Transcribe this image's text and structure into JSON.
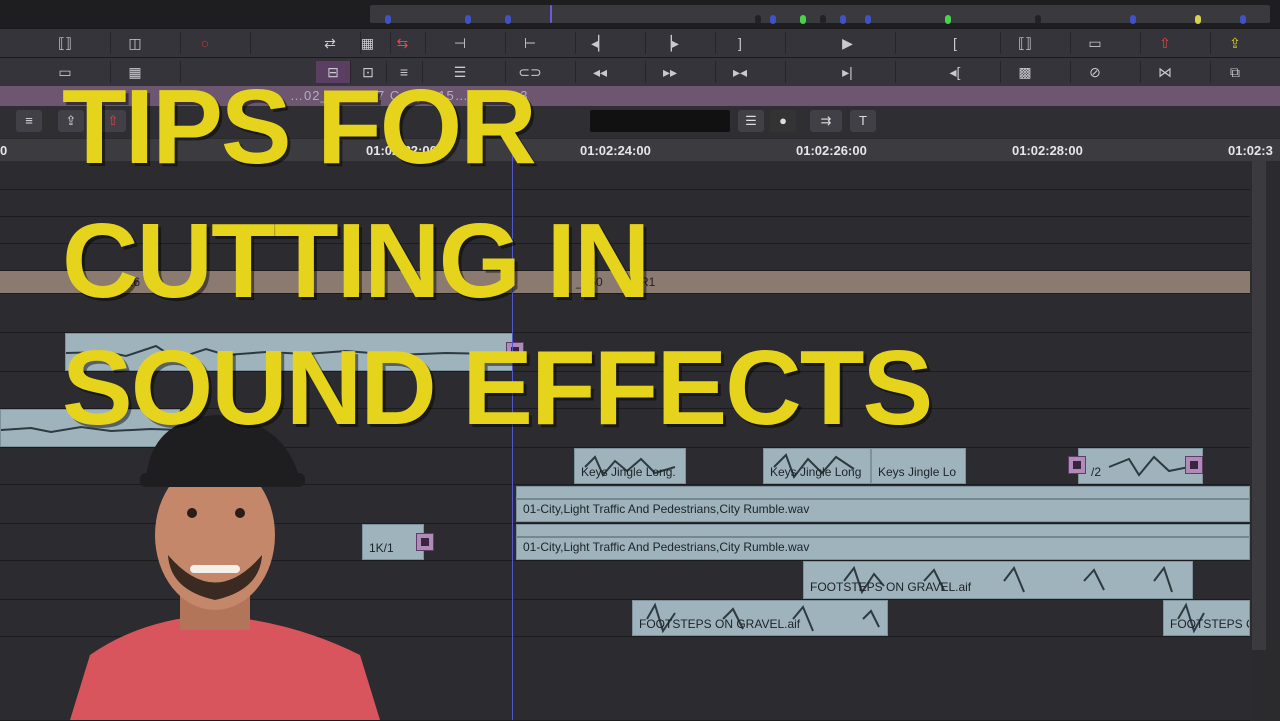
{
  "overlay": {
    "line1": "TIPS FOR",
    "line2": "CUTTING IN",
    "line3": "SOUND EFFECTS",
    "color": "#e6d31c"
  },
  "ruler": {
    "labels": [
      "0",
      "01:02:22:00",
      "01:02:24:00",
      "01:02:26:00",
      "01:02:28:00",
      "01:02:3"
    ]
  },
  "tab": {
    "text": "…02_V0…507 Copy…15…08…23.3"
  },
  "video_track": {
    "label_a": "_16",
    "label_b": "_160",
    "label_c": "R1"
  },
  "clips": {
    "keys1": "Keys Jingle Long.",
    "keys2": "Keys Jingle Long",
    "keys3": "Keys Jingle Lo",
    "part2": "/2",
    "city1": "01-City,Light Traffic And Pedestrians,City Rumble.wav",
    "city2": "01-City,Light Traffic And Pedestrians,City Rumble.wav",
    "small": "1K/1",
    "gravel1": "FOOTSTEPS ON GRAVEL.aif",
    "gravel2": "FOOTSTEPS ON GRAVEL.aif",
    "gravel3": "FOOTSTEPS C"
  },
  "toolbar_icons": {
    "row1": [
      "lift-icon",
      "extract-icon",
      "record-dot",
      "splice-icon",
      "grid-icon",
      "overwrite-icon",
      "mark-in-icon",
      "mark-clip-icon",
      "step-back-icon",
      "step-forward-icon",
      "mark-out-icon",
      "play-icon",
      "go-to-in-icon",
      "split-icon",
      "trim-icon",
      "lift-red-icon",
      "extract-yellow-icon"
    ],
    "row2": [
      "collapse-icon",
      "film-icon",
      "grid2-icon",
      "segment-icon",
      "segment2-icon",
      "segment3-icon",
      "menu-icon",
      "link-icon",
      "rewind-icon",
      "ffwd-icon",
      "jump-back-icon",
      "jump-forward-icon",
      "jump-in-icon",
      "effect-icon",
      "no-icon",
      "match-icon",
      "copy-icon"
    ]
  },
  "colors": {
    "clip": "#9fb3bd",
    "playhead": "#5457c9",
    "video_track": "#8a7a70",
    "effect": "#b08ab9"
  }
}
